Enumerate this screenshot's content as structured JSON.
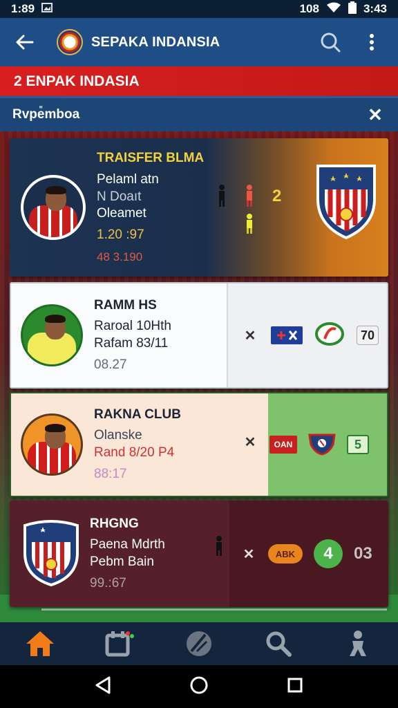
{
  "status_bar": {
    "time": "1:89",
    "right_time": "3:43",
    "carrier": "108"
  },
  "app_bar": {
    "title": "SEPAKA INDANSIA"
  },
  "banner": {
    "text": "2 ENPAK INDASIA"
  },
  "sub_bar": {
    "title": "Rvpe̎mboa"
  },
  "cards": [
    {
      "title": "TRAISFER BLMA",
      "line1": "Pelaml atn",
      "line2": "N Doaıt",
      "line3": "Oleamet",
      "num": "1.20 :97",
      "small": "48 3.190",
      "score": "2"
    },
    {
      "title": "RAMM HS",
      "line1": "Raroal 10Hth",
      "line2": "Rafam 83/11",
      "num": "08.27",
      "badge_text": "70"
    },
    {
      "title": "RAKNA CLUB",
      "line1": "Olanske",
      "line2": "Rand 8/20 P4",
      "num": "88:17",
      "badge_text": "5",
      "chip_text": "OAN"
    },
    {
      "title": "RHGNG",
      "line1": "Paena Mdrth",
      "line2": "Pebm Bain",
      "num": "99.:67",
      "chip_text": "ABK",
      "circle_text": "4",
      "badge_text": "03"
    }
  ],
  "colors": {
    "app_bar": "#1f4e86",
    "banner": "#d81f1f",
    "accent_orange": "#f07b17"
  }
}
